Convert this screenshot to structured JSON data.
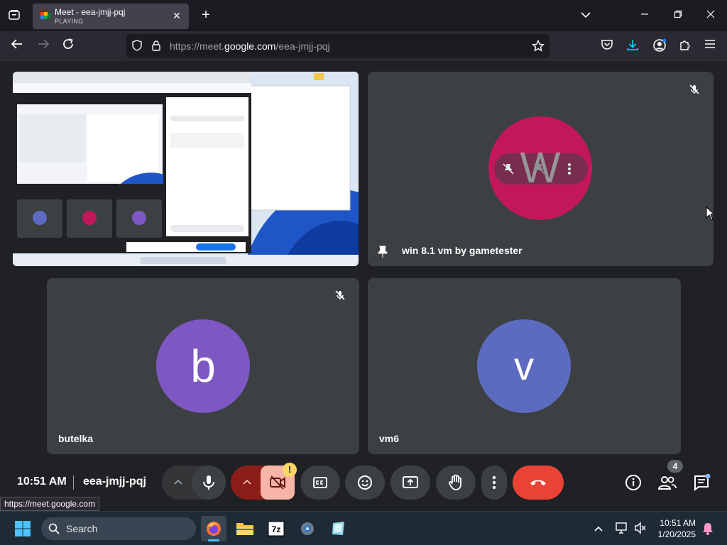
{
  "browser": {
    "tab": {
      "title": "Meet - eea-jmjj-pqj",
      "status": "PLAYING"
    },
    "url": {
      "prefix": "https://meet.",
      "domain": "google.com",
      "path": "/eea-jmjj-pqj"
    },
    "status_url": "https://meet.google.com"
  },
  "participants": [
    {
      "name": "win 8.1 vm by gametester",
      "initial": "W",
      "color": "#c2185b",
      "pinned": true,
      "muted": true
    },
    {
      "name": "butelka",
      "initial": "b",
      "color": "#7e57c2",
      "muted": true
    },
    {
      "name": "vm6",
      "initial": "v",
      "color": "#5c6bc0",
      "muted": false
    }
  ],
  "controls": {
    "time": "10:51 AM",
    "meeting_code": "eea-jmjj-pqj",
    "people_count": "4",
    "camera_alert": "!"
  },
  "taskbar": {
    "search_placeholder": "Search",
    "time": "10:51 AM",
    "date": "1/20/2025"
  },
  "colors": {
    "accent_red": "#ea4335",
    "tile_bg": "#3c4043",
    "page_bg": "#202124"
  }
}
